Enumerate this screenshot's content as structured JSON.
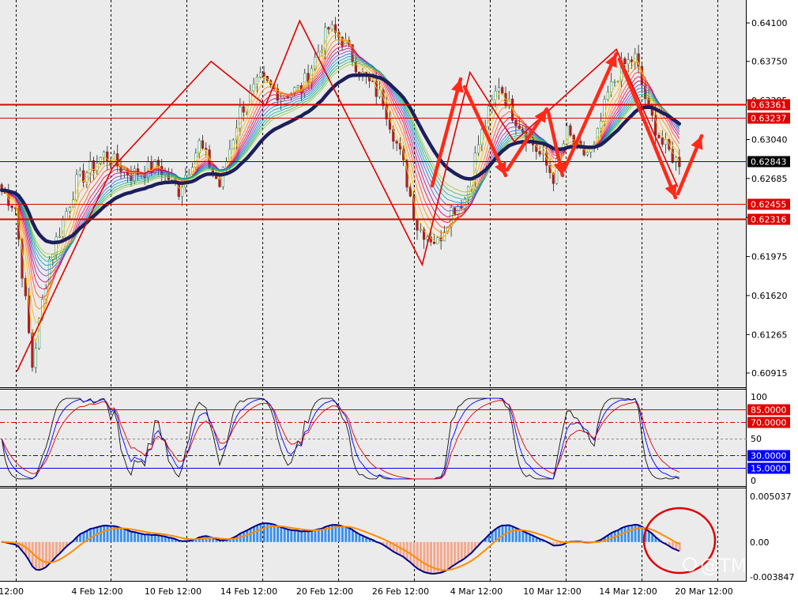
{
  "watermark": "@TMGM",
  "colors": {
    "background": "#ebebeb",
    "axis_bg": "#ffffff",
    "red_line": "#e00000",
    "blue_line": "#0000ff",
    "ma_thick": "#1c1f5a",
    "arrow": "#ff2a1a",
    "hist_pos": "#3a8fe8",
    "hist_neg": "#f4a78a",
    "stoch_black": "#111111",
    "stoch_red": "#e00000",
    "stoch_blue": "#0000ff"
  },
  "chart_data": [
    {
      "type": "candlestick",
      "pair_panel": "price",
      "y_ticks": [
        "0.64100",
        "0.63750",
        "0.63395",
        "0.63040",
        "0.62685",
        "0.62330",
        "0.61975",
        "0.61620",
        "0.61265",
        "0.60915"
      ],
      "ylim": [
        0.608,
        0.6428
      ],
      "x_ticks": [
        "12:00",
        "4 Feb 12:00",
        "10 Feb 12:00",
        "14 Feb 12:00",
        "20 Feb 12:00",
        "26 Feb 12:00",
        "4 Mar 12:00",
        "10 Mar 12:00",
        "14 Mar 12:00",
        "20 Mar 12:00"
      ],
      "horizontal_levels": [
        {
          "label": "0.63361",
          "value": 0.63361,
          "color": "#e00000",
          "width": 2
        },
        {
          "label": "0.63237",
          "value": 0.63237,
          "color": "#e00000",
          "width": 1
        },
        {
          "label": "0.62843",
          "value": 0.62843,
          "color": "#0000ff",
          "width": 1,
          "current": true
        },
        {
          "label": "0.62455",
          "value": 0.62455,
          "color": "#e00000",
          "width": 1
        },
        {
          "label": "0.62316",
          "value": 0.62316,
          "color": "#e00000",
          "width": 2
        }
      ],
      "zigzag": [
        {
          "t": "4 Feb",
          "v": 0.6093
        },
        {
          "t": "10 Feb",
          "v": 0.6278
        },
        {
          "t": "14 Feb",
          "v": 0.6375
        },
        {
          "t": "18 Feb",
          "v": 0.6335
        },
        {
          "t": "20 Feb",
          "v": 0.6412
        },
        {
          "t": "28 Feb",
          "v": 0.619
        },
        {
          "t": "4 Mar",
          "v": 0.6365
        },
        {
          "t": "12 Mar",
          "v": 0.6302
        },
        {
          "t": "14 Mar",
          "v": 0.6386
        },
        {
          "t": "20 Mar",
          "v": 0.6261
        }
      ]
    },
    {
      "type": "line",
      "pair_panel": "stochastic",
      "y_ticks": [
        "100",
        "50",
        "0"
      ],
      "ylim": [
        0,
        100
      ],
      "levels": [
        {
          "label": "85.0000",
          "value": 85,
          "color": "#e00000"
        },
        {
          "label": "70.0000",
          "value": 70,
          "color": "#e00000"
        },
        {
          "label": "30.0000",
          "value": 30,
          "color": "#0000ff"
        },
        {
          "label": "15.0000",
          "value": 15,
          "color": "#0000ff"
        }
      ]
    },
    {
      "type": "bar",
      "pair_panel": "macd",
      "y_ticks": [
        "0.005037",
        "0.00",
        "-0.003847"
      ],
      "ylim": [
        -0.003847,
        0.005037
      ]
    }
  ]
}
